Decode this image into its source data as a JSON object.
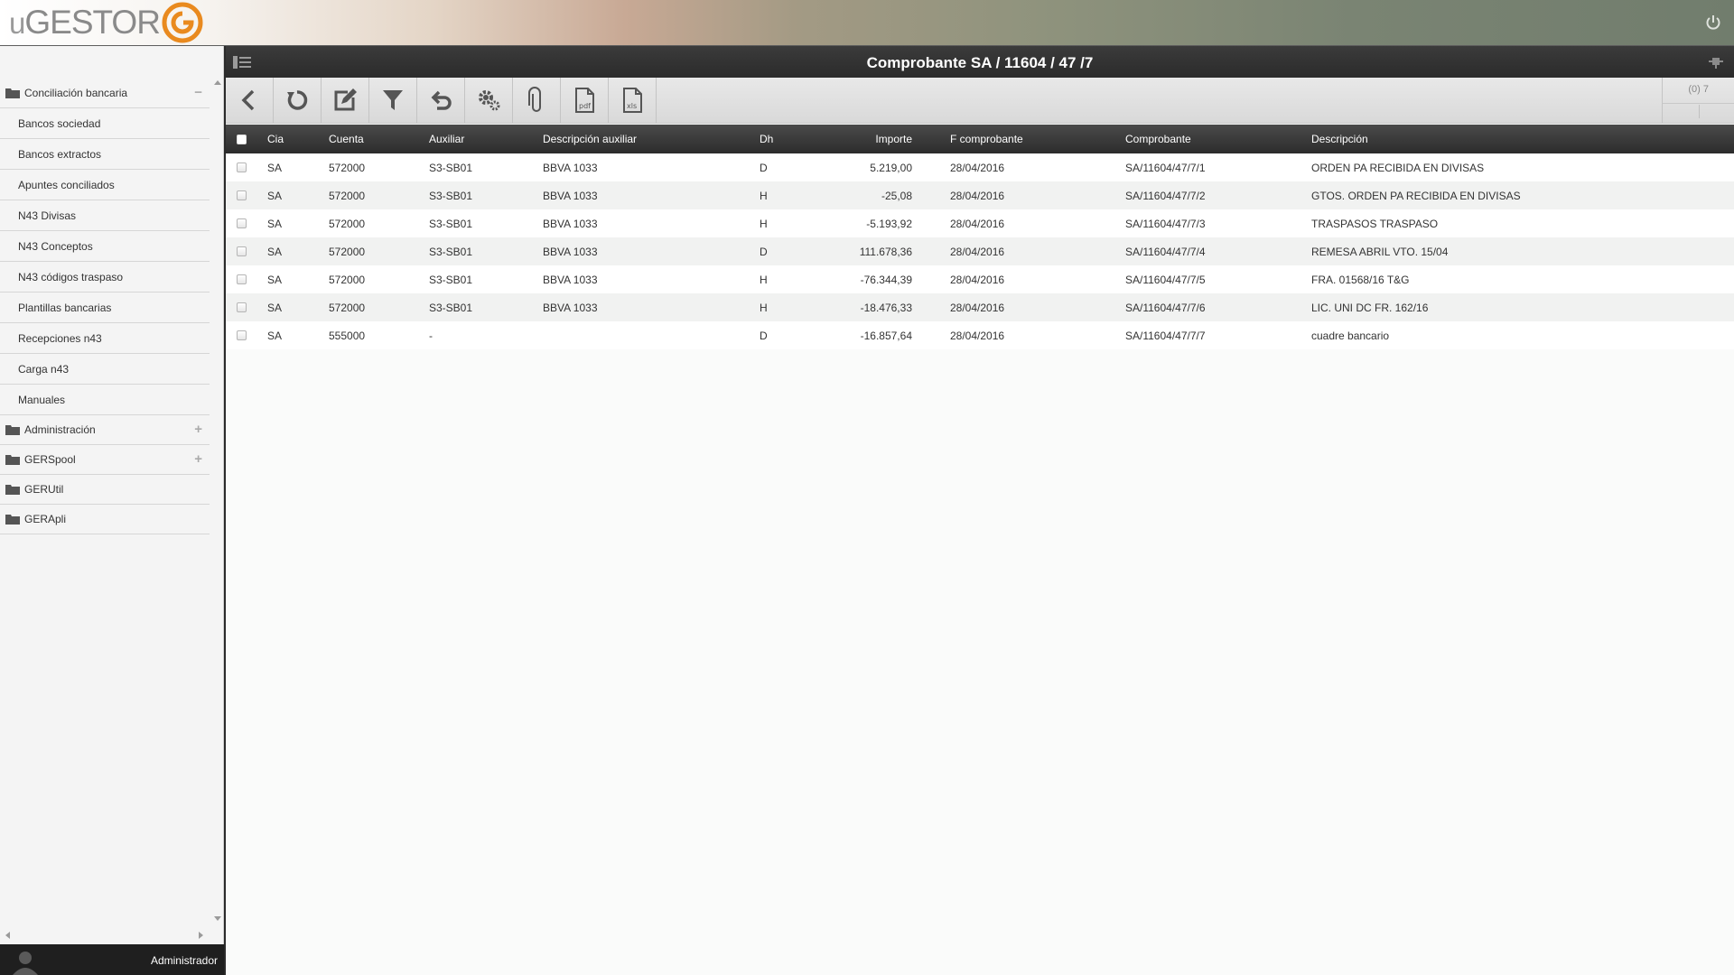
{
  "app": {
    "logo_u": "u",
    "logo_text": "GESTOR",
    "brand_color": "#e98a1f"
  },
  "sidebar": {
    "groups": [
      {
        "label": "Conciliación bancaria",
        "toggle": "−",
        "items": [
          {
            "label": "Bancos sociedad"
          },
          {
            "label": "Bancos extractos"
          },
          {
            "label": "Apuntes conciliados"
          },
          {
            "label": "N43 Divisas"
          },
          {
            "label": "N43 Conceptos"
          },
          {
            "label": "N43 códigos traspaso"
          },
          {
            "label": "Plantillas bancarias"
          },
          {
            "label": "Recepciones n43"
          },
          {
            "label": "Carga n43"
          },
          {
            "label": "Manuales"
          }
        ]
      },
      {
        "label": "Administración",
        "toggle": "+"
      },
      {
        "label": "GERSpool",
        "toggle": "+"
      },
      {
        "label": "GERUtil",
        "toggle": ""
      },
      {
        "label": "GERApli",
        "toggle": ""
      }
    ],
    "user": "Administrador"
  },
  "main": {
    "title": "Comprobante SA / 11604 / 47 /7",
    "toolbar": {
      "buttons": [
        {
          "icon": "back-icon"
        },
        {
          "icon": "refresh-icon"
        },
        {
          "icon": "edit-icon"
        },
        {
          "icon": "filter-icon"
        },
        {
          "icon": "undo-icon"
        },
        {
          "icon": "settings-icon"
        },
        {
          "icon": "attach-icon"
        },
        {
          "icon": "pdf-icon",
          "text": "pdf"
        },
        {
          "icon": "xls-icon",
          "text": "xls"
        }
      ],
      "counter": "(0) 7"
    },
    "table": {
      "columns": {
        "cia": "Cia",
        "cuenta": "Cuenta",
        "auxiliar": "Auxiliar",
        "desc_aux": "Descripción auxiliar",
        "dh": "Dh",
        "importe": "Importe",
        "f_comprobante": "F comprobante",
        "comprobante": "Comprobante",
        "descripcion": "Descripción"
      },
      "rows": [
        {
          "cia": "SA",
          "cuenta": "572000",
          "auxiliar": "S3-SB01",
          "desc_aux": "BBVA 1033",
          "dh": "D",
          "importe": "5.219,00",
          "f_comprobante": "28/04/2016",
          "comprobante": "SA/11604/47/7/1",
          "descripcion": "ORDEN PA RECIBIDA EN DIVISAS"
        },
        {
          "cia": "SA",
          "cuenta": "572000",
          "auxiliar": "S3-SB01",
          "desc_aux": "BBVA 1033",
          "dh": "H",
          "importe": "-25,08",
          "f_comprobante": "28/04/2016",
          "comprobante": "SA/11604/47/7/2",
          "descripcion": "GTOS. ORDEN PA RECIBIDA EN DIVISAS"
        },
        {
          "cia": "SA",
          "cuenta": "572000",
          "auxiliar": "S3-SB01",
          "desc_aux": "BBVA 1033",
          "dh": "H",
          "importe": "-5.193,92",
          "f_comprobante": "28/04/2016",
          "comprobante": "SA/11604/47/7/3",
          "descripcion": "TRASPASOS TRASPASO"
        },
        {
          "cia": "SA",
          "cuenta": "572000",
          "auxiliar": "S3-SB01",
          "desc_aux": "BBVA 1033",
          "dh": "D",
          "importe": "111.678,36",
          "f_comprobante": "28/04/2016",
          "comprobante": "SA/11604/47/7/4",
          "descripcion": "REMESA ABRIL VTO. 15/04"
        },
        {
          "cia": "SA",
          "cuenta": "572000",
          "auxiliar": "S3-SB01",
          "desc_aux": "BBVA 1033",
          "dh": "H",
          "importe": "-76.344,39",
          "f_comprobante": "28/04/2016",
          "comprobante": "SA/11604/47/7/5",
          "descripcion": "FRA. 01568/16 T&G"
        },
        {
          "cia": "SA",
          "cuenta": "572000",
          "auxiliar": "S3-SB01",
          "desc_aux": "BBVA 1033",
          "dh": "H",
          "importe": "-18.476,33",
          "f_comprobante": "28/04/2016",
          "comprobante": "SA/11604/47/7/6",
          "descripcion": "LIC. UNI DC FR. 162/16"
        },
        {
          "cia": "SA",
          "cuenta": "555000",
          "auxiliar": "-",
          "desc_aux": "",
          "dh": "D",
          "importe": "-16.857,64",
          "f_comprobante": "28/04/2016",
          "comprobante": "SA/11604/47/7/7",
          "descripcion": "cuadre bancario"
        }
      ]
    }
  }
}
